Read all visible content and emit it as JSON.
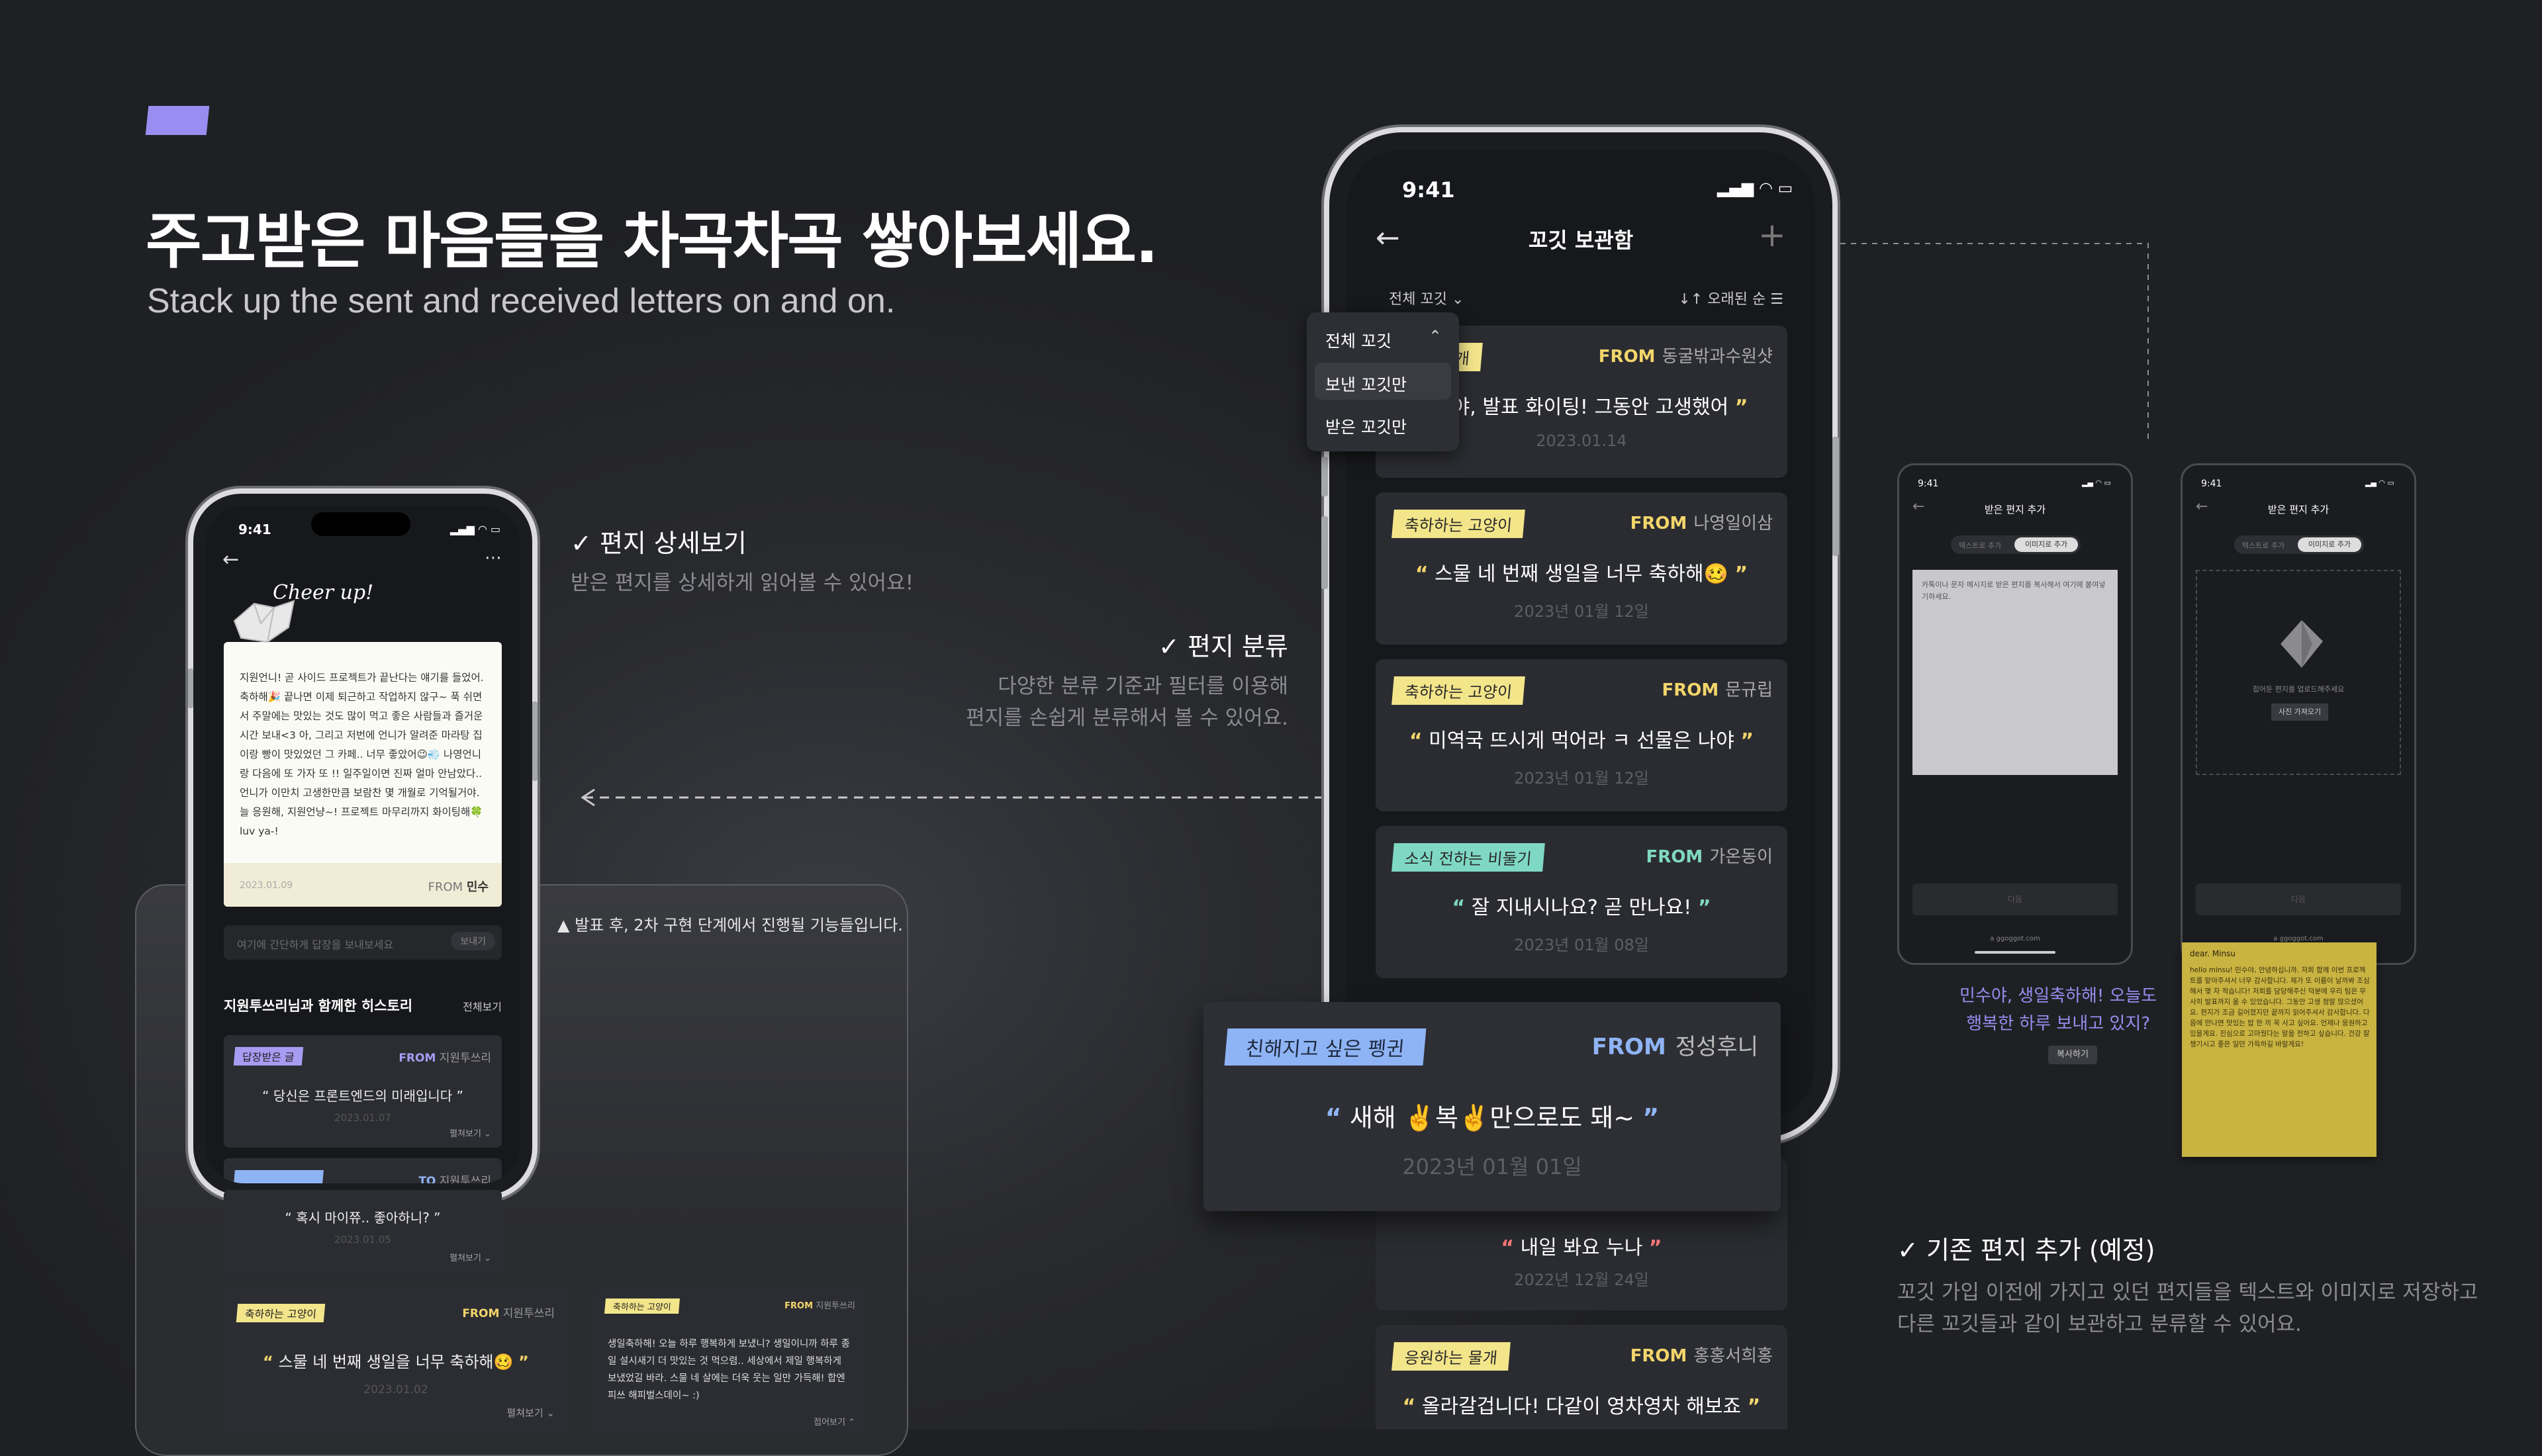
{
  "headline": {
    "title": "주고받은 마음들을 차곡차곡 쌓아보세요.",
    "subtitle": "Stack up the sent and received letters on and on."
  },
  "callouts": {
    "detail": {
      "title": "편지 상세보기",
      "desc": "받은 편지를 상세하게 읽어볼 수 있어요!"
    },
    "classify": {
      "title": "편지 분류",
      "desc1": "다양한 분류 기준과 필터를 이용해",
      "desc2": "편지를 손쉽게 분류해서 볼 수 있어요."
    },
    "add": {
      "title": "기존 편지 추가 (예정)",
      "desc1": "꼬깃 가입 이전에 가지고 있던 편지들을 텍스트와 이미지로 저장하고",
      "desc2": "다른 꼬깃들과 같이 보관하고 분류할 수 있어요."
    },
    "notice": "발표 후, 2차 구현 단계에서 진행될 기능들입니다.",
    "check_mark": "✓"
  },
  "archive_phone": {
    "time": "9:41",
    "title": "꼬깃 보관함",
    "filter_label": "전체 꼬깃",
    "sort_label": "오래된 순",
    "dropdown": [
      "전체 꼬깃",
      "보낸 꼬깃만",
      "받은 꼬깃만"
    ],
    "from_label": "FROM",
    "cards": [
      {
        "tag": "물개",
        "from": "동굴밖과수원샷",
        "quote": "민수야, 발표 화이팅! 그동안 고생했어",
        "date": "2023.01.14",
        "tag_color": "#f3e58a"
      },
      {
        "tag": "축하하는 고양이",
        "from": "나영일이삼",
        "quote": "스물 네 번째 생일을 너무 축하해🥴",
        "date": "2023년 01월 12일",
        "tag_color": "#f3e58a"
      },
      {
        "tag": "축하하는 고양이",
        "from": "문규립",
        "quote": "미역국 뜨시게 먹어라 ㅋ 선물은 나야",
        "date": "2023년 01월 12일",
        "tag_color": "#f3e58a"
      },
      {
        "tag": "소식 전하는 비둘기",
        "from": "가온동이",
        "quote": "잘 지내시나요? 곧 만나요!",
        "date": "2023년 01월 08일",
        "tag_color": "#7fd8c4"
      },
      {
        "tag": "친해지고 싶은 펭귄",
        "from": "정성후니",
        "quote": "새해 ✌️복✌️만으로도 돼~",
        "date": "2023년 01월 01일",
        "tag_color": "#8fb4f5"
      },
      {
        "tag": "",
        "from": "",
        "quote": "내일 봐요 누나",
        "date": "2022년 12월 24일",
        "tag_color": "#f3e58a"
      },
      {
        "tag": "응원하는 물개",
        "from": "홍홍서희홍",
        "quote": "올라갈겁니다! 다같이 영차영차 해보죠",
        "date": "",
        "tag_color": "#f3e58a"
      }
    ]
  },
  "detail_phone": {
    "time": "9:41",
    "cheer": "Cheer up!",
    "letter": [
      "지원언니! 곧 사이드 프로젝트가 끝난다는 얘기를 들었어.",
      "축하해🎉 끝나면 이제 퇴근하고 작업하지 않구~ 푹 쉬면",
      "서 주말에는 맛있는 것도 많이 먹고 좋은 사람들과 즐거운",
      "시간 보내<3 아, 그리고 저번에 언니가 알려준 마라탕 집",
      "이랑 빵이 맛있었던 그 카페.. 너무 좋았어😉💨 나영언니",
      "랑 다음에 또 가자 또 !! 일주일이면 진짜 얼마 안남았다..",
      "언니가 이만치 고생한만큼 보람찬 몇 개월로 기억될거야.",
      "늘 응원해, 지원언냥~! 프로젝트 마무리까지 화이팅해🍀",
      "luv ya-!"
    ],
    "letter_date": "2023.01.09",
    "letter_from": "민수",
    "reply_placeholder": "여기에 간단하게 답장을 보내보세요",
    "reply_button": "보내기",
    "history_title": "지원투쓰리님과 함께한 히스토리",
    "history_all": "전체보기",
    "history": [
      {
        "tag": "답장받은 글",
        "dir": "FROM",
        "who": "지원투쓰리",
        "quote": "당신은 프론트엔드의 미래입니다",
        "date": "2023.01.07",
        "more": "펼쳐보기"
      },
      {
        "tag": "",
        "dir": "TO",
        "who": "지원투쓰리",
        "quote": "혹시 마이쮸.. 좋아하니?",
        "date": "2023.01.05",
        "more": "펼쳐보기"
      },
      {
        "tag": "축하하는 고양이",
        "dir": "FROM",
        "who": "지원투쓰리",
        "quote": "스물 네 번째 생일을 너무 축하해🥴",
        "date": "2023.01.02",
        "more": "펼쳐보기"
      },
      {
        "tag": "축하하는 고양이",
        "dir": "FROM",
        "who": "지원투쓰리",
        "quote": "생일축하해! 오늘 하루 행복하게 보냈니? 생일이니까 하루 종일 설시새기 더 맛있는 것 먹으렴.. 세상에서 제일 행복하게 보냈었길 바라. 스물 네 살에는 더욱 웃는 일만 가득해! 합엔피쓰 해피벌스데이~ :)",
        "date": "",
        "more": "접어보기"
      }
    ]
  },
  "add_screens": {
    "time": "9:41",
    "title": "받은 편지 추가",
    "seg": [
      "텍스트로 추가",
      "이미지로 추가"
    ],
    "text_hint": "카톡이나 문자 메시지로 받은 편지를 복사해서 여기에 붙여넣기하세요.",
    "image_hint": "접어둔 편지를 업로드해주세요",
    "image_button": "사진 가져오기",
    "next": "다음",
    "site": "ggoggot.com",
    "bubble_text1": "민수야, 생일축하해! 오늘도",
    "bubble_text2": "행복한 하루 보내고 있지?",
    "copy_button": "복사하기",
    "note_title": "dear. Minsu",
    "note_body": "hello minsu! 민수야, 안녕하십니까. 저희 함께 이번 프로젝트를 맡아주셔서 너무 감사합니다. 제가 또 이름이 날까봐 조심해서 몇 자 적습니다! 저희를 담당해주신 덕분에 우리 팀은 무사히 발표까지 올 수 있었습니다. 그동안 고생 정말 많으셨어요. 편지가 조금 길어졌지만 끝까지 읽어주셔서 감사합니다. 다음에 만나면 맛있는 밥 한 끼 꼭 사고 싶어요. 언제나 응원하고 있을게요. 진심으로 고마웠다는 말을 전하고 싶습니다. 건강 잘 챙기시고 좋은 일만 가득하길 바랄게요!"
  }
}
